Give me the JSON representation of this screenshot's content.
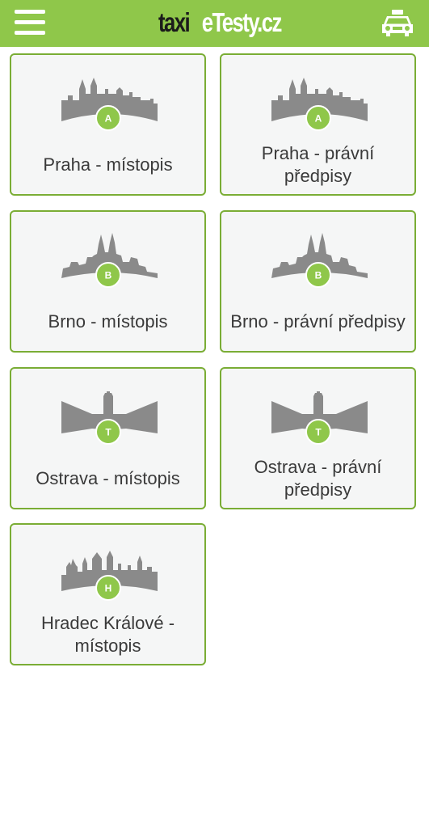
{
  "header": {
    "logo_part1": "taxi",
    "logo_part2": "eTesty.cz",
    "menu_icon": "hamburger-menu-icon",
    "taxi_icon": "taxi-car-icon",
    "colors": {
      "bar": "#8fc74a",
      "card_border": "#7aad35",
      "badge": "#8fc74a"
    }
  },
  "cards": [
    {
      "label": "Praha - místopis",
      "badge": "A",
      "skyline": "praha"
    },
    {
      "label": "Praha - právní předpisy",
      "badge": "A",
      "skyline": "praha"
    },
    {
      "label": "Brno - místopis",
      "badge": "B",
      "skyline": "brno"
    },
    {
      "label": "Brno - právní předpisy",
      "badge": "B",
      "skyline": "brno"
    },
    {
      "label": "Ostrava - místopis",
      "badge": "T",
      "skyline": "ostrava"
    },
    {
      "label": "Ostrava - právní předpisy",
      "badge": "T",
      "skyline": "ostrava"
    },
    {
      "label": "Hradec Králové - místopis",
      "badge": "H",
      "skyline": "hradec"
    }
  ]
}
